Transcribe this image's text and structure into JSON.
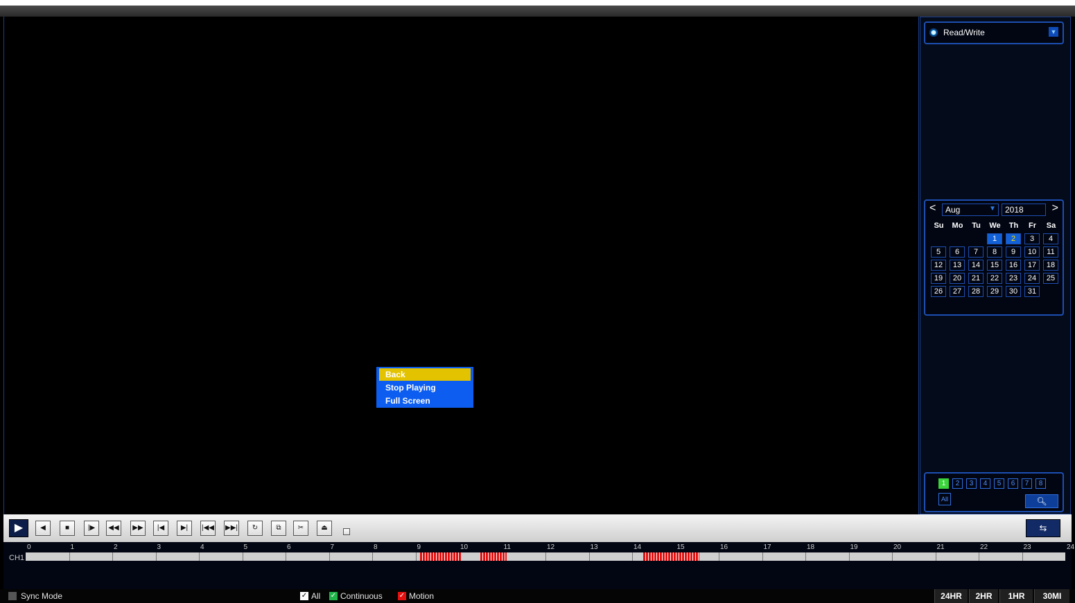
{
  "right_panel": {
    "mode_label": "Read/Write",
    "calendar": {
      "month": "Aug",
      "year": "2018",
      "weekdays": [
        "Su",
        "Mo",
        "Tu",
        "We",
        "Th",
        "Fr",
        "Sa"
      ],
      "days": [
        "1",
        "2",
        "3",
        "4",
        "5",
        "6",
        "7",
        "8",
        "9",
        "10",
        "11",
        "12",
        "13",
        "14",
        "15",
        "16",
        "17",
        "18",
        "19",
        "20",
        "21",
        "22",
        "23",
        "24",
        "25",
        "26",
        "27",
        "28",
        "29",
        "30",
        "31"
      ],
      "first_weekday_index": 3,
      "recorded_days": [
        1
      ],
      "selected_day": 2
    },
    "channels": [
      "1",
      "2",
      "3",
      "4",
      "5",
      "6",
      "7",
      "8"
    ],
    "channel_selected": "1",
    "channels_all_label": "All",
    "search_icon": "magnifier-icon"
  },
  "context_menu": {
    "items": [
      "Back",
      "Stop Playing",
      "Full Screen"
    ],
    "active_item": "Back"
  },
  "controls": {
    "play_icon": "play-icon",
    "buttons": [
      "prev-frame-icon",
      "stop-icon",
      "slow-icon",
      "rewind-icon",
      "fast-forward-icon",
      "prev-record-icon",
      "next-record-icon",
      "skip-back-icon",
      "skip-forward-icon",
      "refresh-icon",
      "multi-screen-icon",
      "clip-icon",
      "backup-icon"
    ],
    "right_button_icon": "switch-icon"
  },
  "timeline": {
    "channel_label": "CH1",
    "hour_ticks": [
      "0",
      "1",
      "2",
      "3",
      "4",
      "5",
      "6",
      "7",
      "8",
      "9",
      "10",
      "11",
      "12",
      "13",
      "14",
      "15",
      "16",
      "17",
      "18",
      "19",
      "20",
      "21",
      "22",
      "23",
      "24"
    ],
    "motion_segments_hours": [
      [
        9.1,
        10.05
      ],
      [
        10.5,
        11.1
      ],
      [
        14.25,
        15.55
      ]
    ]
  },
  "footer": {
    "sync_label": "Sync Mode",
    "filter_all": "All",
    "filter_continuous": "Continuous",
    "filter_motion": "Motion",
    "zoom_buttons": [
      "24HR",
      "2HR",
      "1HR",
      "30MI"
    ],
    "colors": {
      "continuous": "#21b34a",
      "motion": "#e31010",
      "accent": "#1d4fb3"
    }
  }
}
